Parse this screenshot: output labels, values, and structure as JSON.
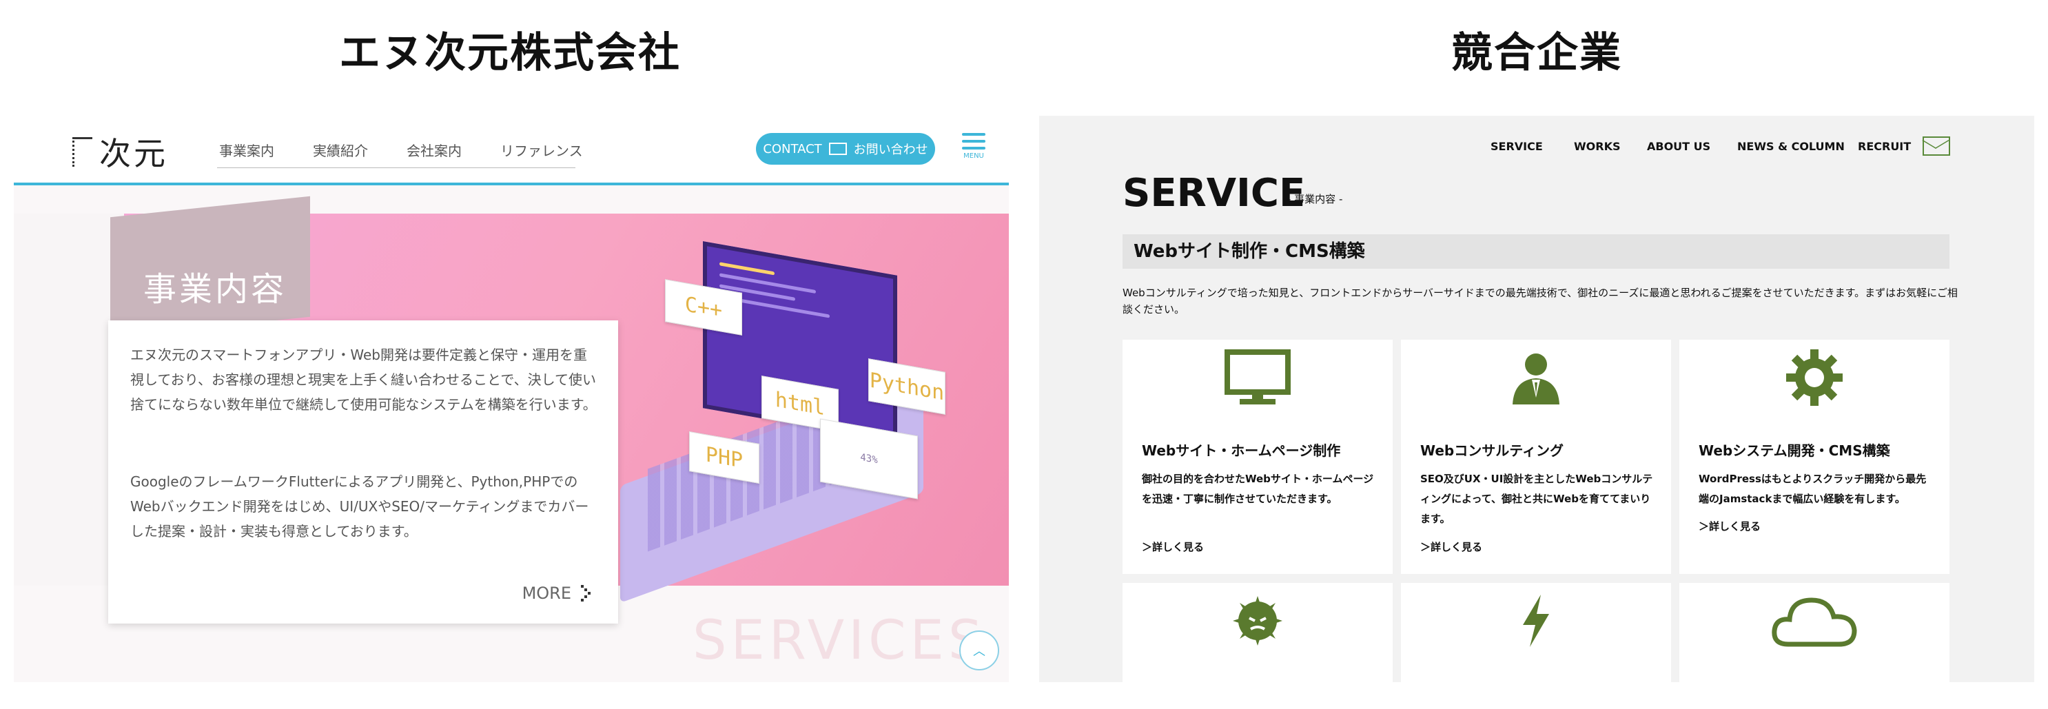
{
  "headings": {
    "left": "エヌ次元株式会社",
    "right": "競合企業"
  },
  "left": {
    "logo": "次元",
    "nav": [
      "事業案内",
      "実績紹介",
      "会社案内",
      "リファレンス"
    ],
    "contact": {
      "label_en": "CONTACT",
      "label_ja": "お問い合わせ"
    },
    "menu_label": "MENU",
    "hero_title": "事業内容",
    "paragraph1": "エヌ次元のスマートフォンアプリ・Web開発は要件定義と保守・運用を重視しており、お客様の理想と現実を上手く縫い合わせることで、決して使い捨てにならない数年単位で継続して使用可能なシステムを構築を行います。",
    "paragraph2": "GoogleのフレームワークFlutterによるアプリ開発と、Python,PHPでのWebバックエンド開発をはじめ、UI/UXやSEO/マーケティングまでカバーした提案・設計・実装も得意としております。",
    "more": "MORE",
    "watermark": "SERVICES",
    "illustration_labels": [
      "C++",
      "Python",
      "html",
      "PHP",
      "43%"
    ]
  },
  "right": {
    "nav": [
      "SERVICE",
      "WORKS",
      "ABOUT US",
      "NEWS & COLUMN",
      "RECRUIT"
    ],
    "title": "SERVICE",
    "subtitle": "- 事業内容 -",
    "section": "Webサイト制作・CMS構築",
    "intro": "Webコンサルティングで培った知見と、フロントエンドからサーバーサイドまでの最先端技術で、御社のニーズに最適と思われるご提案をさせていただきます。まずはお気軽にご相談ください。",
    "cards": [
      {
        "title": "Webサイト・ホームページ制作",
        "desc": "御社の目的を合わせたWebサイト・ホームページを迅速・丁寧に制作させていただきます。",
        "link": "＞詳しく見る",
        "icon": "monitor-icon"
      },
      {
        "title": "Webコンサルティング",
        "desc": "SEO及びUX・UI設計を主としたWebコンサルティングによって、御社と共にWebを育ててまいります。",
        "link": "＞詳しく見る",
        "icon": "consultant-icon"
      },
      {
        "title": "Webシステム開発・CMS構築",
        "desc": "WordPressはもとよりスクラッチ開発から最先端のJamstackまで幅広い経験を有します。",
        "link": "＞詳しく見る",
        "icon": "gear-icon"
      }
    ],
    "bottom_icons": [
      "virus-icon",
      "lightning-icon",
      "cloud-icon"
    ]
  },
  "colors": {
    "accent_blue": "#3db6d9",
    "accent_green": "#5a7a2e",
    "hero_pink": "#f6a8d9"
  }
}
